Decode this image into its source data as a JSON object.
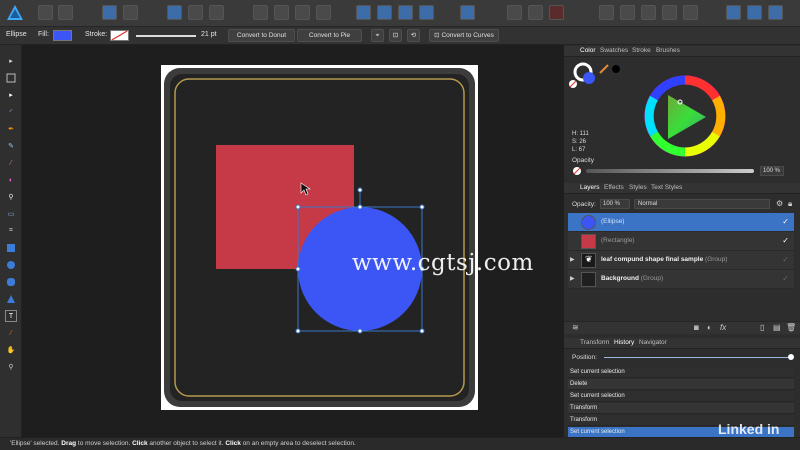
{
  "context_bar": {
    "tool_name": "Ellipse",
    "fill_label": "Fill:",
    "fill_color": "#3b56f5",
    "stroke_label": "Stroke:",
    "stroke_width": "21 pt",
    "convert_donut": "Convert to Donut",
    "convert_pie": "Convert to Pie",
    "convert_curves": "Convert to Curves"
  },
  "colors": {
    "rectangle": "#c63a47",
    "ellipse": "#3b56f5",
    "frame": "#3c3c3c",
    "frame_inner": "#232323",
    "gold_border": "#b59a4e",
    "selection": "#3b74c4"
  },
  "color_panel": {
    "tabs": [
      "Color",
      "Swatches",
      "Stroke",
      "Brushes"
    ],
    "h": "H: 111",
    "s": "S: 26",
    "l": "L: 67",
    "opacity_label": "Opacity",
    "opacity_value": "100 %"
  },
  "layers_panel": {
    "tabs": [
      "Layers",
      "Effects",
      "Styles",
      "Text Styles"
    ],
    "opacity_label": "Opacity:",
    "opacity_value": "100 %",
    "blend_mode": "Normal",
    "layers": [
      {
        "name": "",
        "type": "(Ellipse)",
        "checked": true
      },
      {
        "name": "",
        "type": "(Rectangle)",
        "checked": true
      },
      {
        "name": "leaf compund shape final sample",
        "type": "(Group)",
        "checked": false
      },
      {
        "name": "Background",
        "type": "(Group)",
        "checked": false
      }
    ]
  },
  "history_panel": {
    "tabs": [
      "Transform",
      "History",
      "Navigator"
    ],
    "position_label": "Position:",
    "items": [
      "Set current selection",
      "Delete",
      "Set current selection",
      "Transform",
      "Transform",
      "Set current selection"
    ]
  },
  "status": {
    "p1": "'Ellipse' selected. ",
    "drag": "Drag",
    "p2": " to move selection. ",
    "click1": "Click",
    "p3": " another object to select it. ",
    "click2": "Click",
    "p4": " on an empty area to deselect selection."
  },
  "overlay": {
    "watermark": "www.cgtsj.com",
    "brand": "Linked in"
  }
}
